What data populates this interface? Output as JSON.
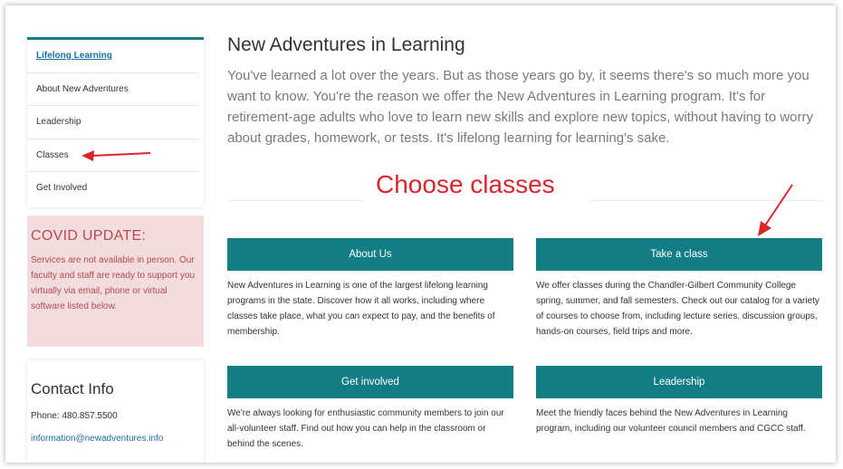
{
  "sidebar": {
    "items": [
      {
        "label": "Lifelong Learning"
      },
      {
        "label": "About New Adventures"
      },
      {
        "label": "Leadership"
      },
      {
        "label": "Classes"
      },
      {
        "label": "Get Involved"
      }
    ]
  },
  "covid": {
    "title": "COVID UPDATE:",
    "text": "Services are not available in person. Our faculty and staff are ready to support you virtually via email, phone or virtual software listed below."
  },
  "contact": {
    "title": "Contact Info",
    "phone": "Phone: 480.857.5500",
    "email": "information@newadventures.info"
  },
  "main": {
    "title": "New Adventures in Learning",
    "intro": "You've learned a lot over the years. But as those years go by, it seems there's so much more you want to know. You're the reason we offer the New Adventures in Learning program. It's for retirement-age adults who love to learn new skills and explore new topics, without having to worry about grades, homework, or tests. It's lifelong learning for learning's sake.",
    "annotation": "Choose classes",
    "cards": [
      {
        "label": "About Us",
        "text": "New Adventures in Learning is one of the largest lifelong learning programs in the state. Discover how it all works, including where classes take place, what you can expect to pay, and the benefits of membership."
      },
      {
        "label": "Take a class",
        "text": "We offer classes during the Chandler-Gilbert Community College spring, summer, and fall semesters. Check out our catalog for a variety of courses to choose from, including lecture series, discussion groups, hands-on courses, field trips and more."
      },
      {
        "label": "Get involved",
        "text": "We're always looking for enthusiastic community members to join our all-volunteer staff. Find out how you can help in the classroom or behind the scenes."
      },
      {
        "label": "Leadership",
        "text": "Meet the friendly faces behind the New Adventures in Learning program, including our volunteer council members and CGCC staff."
      }
    ]
  },
  "colors": {
    "teal": "#137d84",
    "annotation_red": "#d9262c",
    "covid_bg": "#f3dcde"
  }
}
